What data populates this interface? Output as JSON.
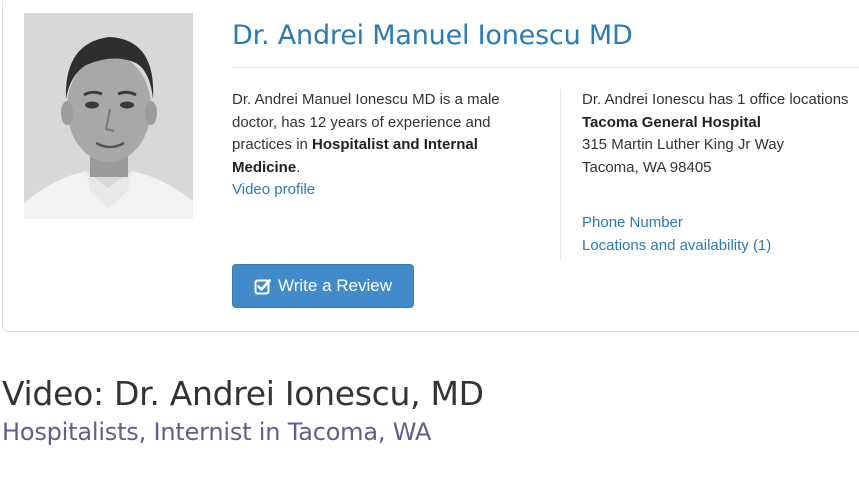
{
  "doctor": {
    "name": "Dr. Andrei Manuel Ionescu MD",
    "bio_intro": "Dr. Andrei Manuel Ionescu MD is a male doctor, has 12 years of experience and practices in ",
    "specialties": "Hospitalist and Internal Medicine",
    "bio_end": ".",
    "video_profile_link": "Video profile"
  },
  "office": {
    "summary": "Dr. Andrei Ionescu has 1 office locations",
    "hospital": "Tacoma General Hospital",
    "street": "315 Martin Luther King Jr Way",
    "city": "Tacoma, WA 98405",
    "phone_link": "Phone Number",
    "locations_link": "Locations and availability (1)"
  },
  "actions": {
    "write_review": "Write a Review",
    "write_review_icon": "check-square-icon"
  },
  "video": {
    "title": "Video: Dr. Andrei Ionescu, MD",
    "subtitle": "Hospitalists, Internist in Tacoma, WA"
  },
  "colors": {
    "link": "#2a7ab8",
    "button": "#428bca",
    "subtitle": "#6a5a8c"
  }
}
